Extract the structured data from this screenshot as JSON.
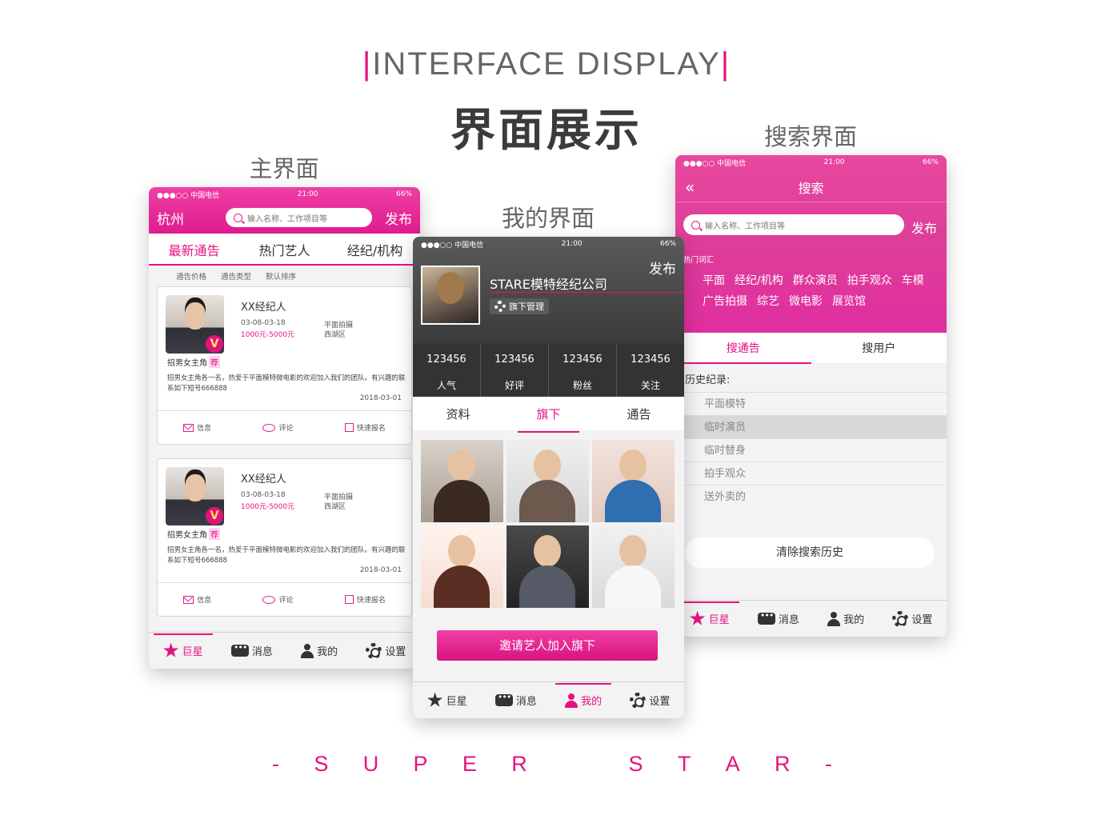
{
  "header": {
    "title_en": "INTERFACE DISPLAY",
    "title_en_bar": "|",
    "title_cn": "界面展示"
  },
  "labels": {
    "main": "主界面",
    "mine": "我的界面",
    "search": "搜索界面"
  },
  "footer_letters": [
    "-",
    "S",
    "U",
    "P",
    "E",
    "R",
    "S",
    "T",
    "A",
    "R",
    "-"
  ],
  "colors": {
    "accent": "#e3127f",
    "dark_header": "#3a3a3a"
  },
  "status": {
    "carrier": "●●●○○ 中国电信",
    "time": "21:00",
    "battery": "66%"
  },
  "main_screen": {
    "city": "杭州",
    "search_placeholder": "输入名称、工作项目等",
    "publish": "发布",
    "tabs": [
      "最新通告",
      "热门艺人",
      "经纪/机构"
    ],
    "filters": [
      "通告价格",
      "通告类型",
      "默认排序"
    ],
    "cards": [
      {
        "agent": "XX经纪人",
        "date": "03-08-03-18",
        "price": "1000元-5000元",
        "category": "平面拍摄",
        "area": "西湖区",
        "role": "招男女主角",
        "tag": "荐",
        "desc": "招男女主角各一名，热爱于平面模特微电影的欢迎加入我们的团队。有兴趣的联系如下短号666888",
        "posted": "2018-03-01",
        "actions": [
          "信息",
          "评论",
          "快速报名"
        ]
      },
      {
        "agent": "XX经纪人",
        "date": "03-08-03-18",
        "price": "1000元-5000元",
        "category": "平面拍摄",
        "area": "西湖区",
        "role": "招男女主角",
        "tag": "荐",
        "desc": "招男女主角各一名，热爱于平面模特微电影的欢迎加入我们的团队。有兴趣的联系如下短号666888",
        "posted": "2018-03-01",
        "actions": [
          "信息",
          "评论",
          "快速报名"
        ]
      }
    ]
  },
  "mine_screen": {
    "publish": "发布",
    "company": "STARE模特经纪公司",
    "manage": "旗下管理",
    "stats": [
      {
        "value": "123456",
        "label": "人气"
      },
      {
        "value": "123456",
        "label": "好评"
      },
      {
        "value": "123456",
        "label": "粉丝"
      },
      {
        "value": "123456",
        "label": "关注"
      }
    ],
    "tabs": [
      "资料",
      "旗下",
      "通告"
    ],
    "invite": "邀请艺人加入旗下"
  },
  "search_screen": {
    "title": "搜索",
    "back_icon": "«",
    "search_placeholder": "输入名称、工作项目等",
    "publish": "发布",
    "hot_label": "热门词汇",
    "hot_words": [
      "平面",
      "经纪/机构",
      "群众演员",
      "拍手观众",
      "车模",
      "广告拍摄",
      "综艺",
      "微电影",
      "展览馆"
    ],
    "tabs": [
      "搜通告",
      "搜用户"
    ],
    "history_label": "历史纪录:",
    "history": [
      "平面模特",
      "临时演员",
      "临时替身",
      "拍手观众",
      "送外卖的"
    ],
    "clear": "清除搜索历史"
  },
  "bottom_nav": [
    "巨星",
    "消息",
    "我的",
    "设置"
  ]
}
